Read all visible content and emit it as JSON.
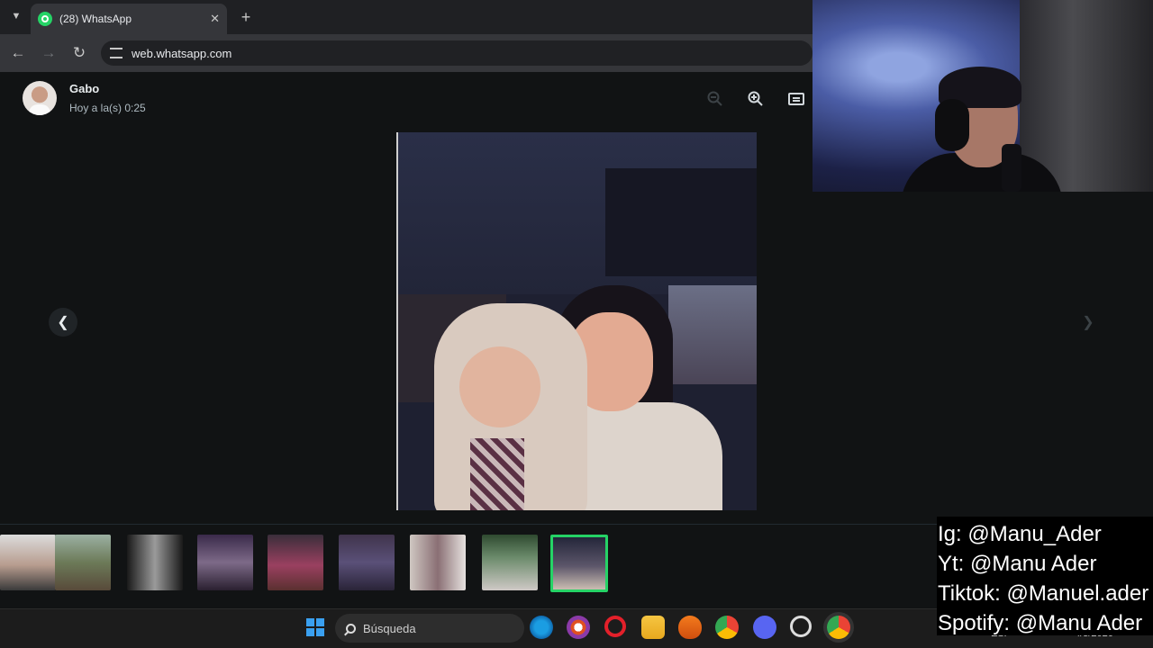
{
  "browser": {
    "tab_title": "(28) WhatsApp",
    "url": "web.whatsapp.com",
    "icons": [
      "chevron-down-icon",
      "whatsapp-icon",
      "close-icon",
      "plus-icon",
      "back-icon",
      "forward-icon",
      "reload-icon",
      "site-settings-icon"
    ]
  },
  "viewer": {
    "contact_name": "Gabo",
    "timestamp": "Hoy a la(s) 0:25",
    "icons": [
      "zoom-out-icon",
      "zoom-in-icon",
      "message-icon",
      "chevron-left-icon",
      "chevron-right-icon"
    ],
    "thumbnail_count": 9,
    "active_thumbnail": 9
  },
  "taskbar": {
    "search_label": "Búsqueda",
    "date_partial": "4/3/2026",
    "lang_partial": "ESP"
  },
  "overlay": {
    "socials": [
      "Ig: @Manu_Ader",
      "Yt: @Manu Ader",
      "Tiktok: @Manuel.ader",
      "Spotify: @Manu Ader"
    ]
  },
  "colors": {
    "whatsapp_green": "#25d366",
    "viewer_bg": "#111314",
    "chrome_tab": "#35363a"
  }
}
